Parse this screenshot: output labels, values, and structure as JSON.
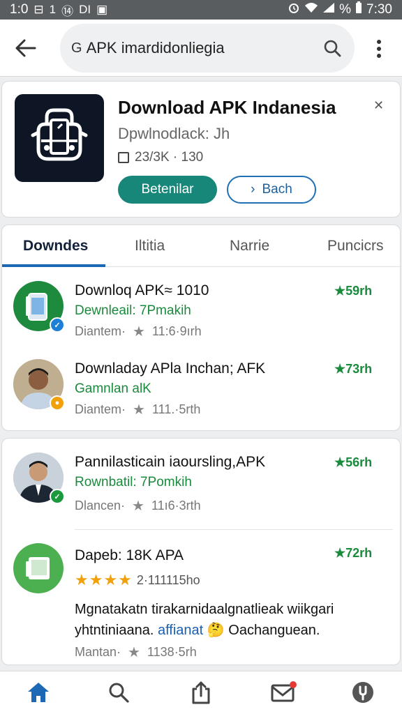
{
  "status_bar": {
    "left_time": "1:0",
    "left_icons": [
      "⊟",
      "1",
      "⑭",
      "DI",
      "▣"
    ],
    "battery": "%",
    "time": "7:30"
  },
  "app_bar": {
    "search_prefix": "G",
    "search_text": "APK imardidonliegia"
  },
  "hero": {
    "title": "Download APK Indanesia",
    "subtitle": "Dpwlnodlack: Jh",
    "meta": "23/3K · 130",
    "primary_button": "Betenilar",
    "secondary_button": "Bach",
    "secondary_icon": "›",
    "close_glyph": "✕"
  },
  "tabs": [
    {
      "label": "Downdes",
      "active": true
    },
    {
      "label": "Iltitia",
      "active": false
    },
    {
      "label": "Narrie",
      "active": false
    },
    {
      "label": "Puncicrs",
      "active": false
    }
  ],
  "list_a": [
    {
      "title": "Downloq APK≈ 1010",
      "link": "Dewnleail: 7Pmakih",
      "meta_label": "Diantem·",
      "meta_value": "11:6·9ırh",
      "rating": "★59rh",
      "badge_color": "#1e7fd6",
      "badge_glyph": "✓"
    },
    {
      "title": "Downladay APla Inchan; AFK",
      "link": "Gamnlan alK",
      "meta_label": "Diantem·",
      "meta_value": "111.·5rth",
      "rating": "★73rh",
      "badge_color": "#f1a10b",
      "badge_glyph": "●"
    }
  ],
  "list_b": [
    {
      "title": "Pannilasticain iaoursling,APK",
      "link": "Rownbatil: 7Pomkih",
      "meta_label": "Dlancen·",
      "meta_value": "11ı6·3rth",
      "rating": "★56rh",
      "badge_color": "#1a9a3c",
      "badge_glyph": "✓"
    },
    {
      "title": "Dapeb: 18K APA",
      "stars": "★★★★",
      "stars_count": "2·111115hо",
      "desc_a": "Mgnatakatn tirakarnidaalgnatlieak wiikgari yhtntiniaana.",
      "desc_hl": "affianat",
      "desc_b": "Oachanguean.",
      "meta_label": "Mantan·",
      "meta_value": "1138·5rh",
      "rating": "★72rh"
    }
  ],
  "colors": {
    "accent_teal": "#17877a",
    "accent_blue": "#1c68b4",
    "link_green": "#1a8a3c",
    "gold": "#f1a10b"
  },
  "bottom_nav": [
    {
      "icon": "home-icon",
      "active": true
    },
    {
      "icon": "search-icon",
      "active": false
    },
    {
      "icon": "share-icon",
      "active": false
    },
    {
      "icon": "mail-icon",
      "active": false,
      "notification": true
    },
    {
      "icon": "settings-icon",
      "active": false
    }
  ]
}
